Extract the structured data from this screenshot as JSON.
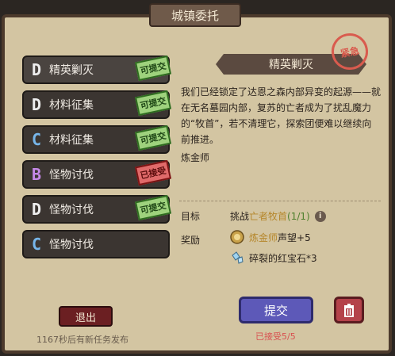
{
  "header": {
    "title": "城镇委托"
  },
  "quests": [
    {
      "rank": "D",
      "rank_class": "d",
      "name": "精英剿灭",
      "stamp": "可提交",
      "stamp_color": "green"
    },
    {
      "rank": "D",
      "rank_class": "d",
      "name": "材料征集",
      "stamp": "可提交",
      "stamp_color": "green"
    },
    {
      "rank": "C",
      "rank_class": "c",
      "name": "材料征集",
      "stamp": "可提交",
      "stamp_color": "green"
    },
    {
      "rank": "B",
      "rank_class": "b",
      "name": "怪物讨伐",
      "stamp": "已接受",
      "stamp_color": "red"
    },
    {
      "rank": "D",
      "rank_class": "d",
      "name": "怪物讨伐",
      "stamp": "可提交",
      "stamp_color": "green"
    },
    {
      "rank": "C",
      "rank_class": "c",
      "name": "怪物讨伐",
      "stamp": "",
      "stamp_color": ""
    }
  ],
  "detail": {
    "title": "精英剿灭",
    "seal": "紧急",
    "description": "我们已经锁定了达恩之森内部异变的起源——就在无名墓园内部，复苏的亡者成为了扰乱魔力的“牧首”，若不清理它，探索团便难以继续向前推进。",
    "client": "炼金师",
    "goal_label": "目标",
    "goal_prefix": "挑战",
    "goal_target": "亡者牧首",
    "goal_progress": "(1/1)",
    "reward_label": "奖励",
    "reward1_hl": "炼金师",
    "reward1_text": "声望+5",
    "reward2_text": "碎裂的红宝石*3"
  },
  "actions": {
    "submit_label": "提交",
    "accepted_status": "已接受5/5",
    "exit_label": "退出",
    "countdown": "1167秒后有新任务发布"
  },
  "colors": {
    "panel": "#d3c5a2",
    "frame": "#4c3a2c",
    "submit": "#5d59b8",
    "trash": "#b4424a",
    "exit": "#6b1f22"
  }
}
